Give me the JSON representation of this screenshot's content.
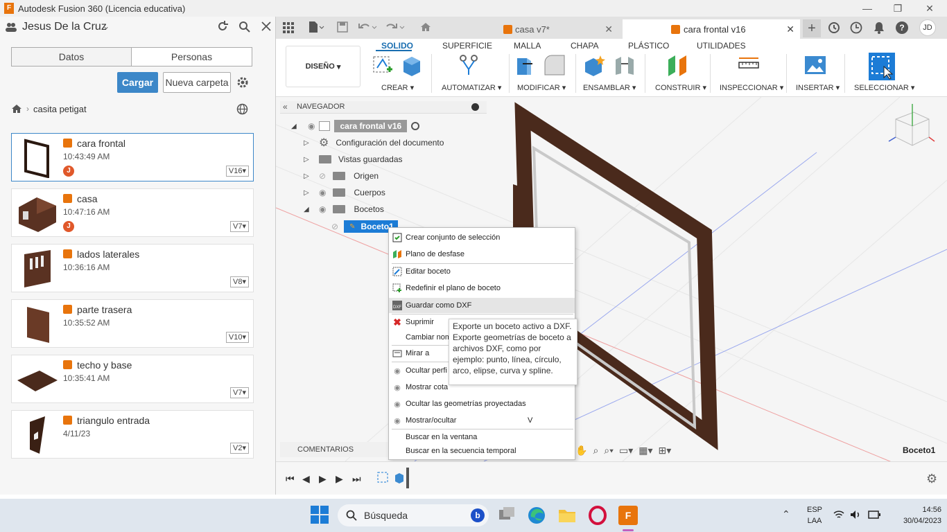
{
  "window": {
    "title": "Autodesk Fusion 360 (Licencia educativa)",
    "controls": [
      "—",
      "❐",
      "✕"
    ]
  },
  "left": {
    "user_name": "Jesus De la Cruz",
    "segments": [
      "Datos",
      "Personas"
    ],
    "upload_label": "Cargar",
    "new_folder_label": "Nueva carpeta",
    "breadcrumb": "casita petigat",
    "files": [
      {
        "name": "cara frontal",
        "time": "10:43:49 AM",
        "version": "V16",
        "avatar": "J"
      },
      {
        "name": "casa",
        "time": "10:47:16 AM",
        "version": "V7",
        "avatar": "J"
      },
      {
        "name": "lados laterales",
        "time": "10:36:16 AM",
        "version": "V8",
        "avatar": ""
      },
      {
        "name": "parte trasera",
        "time": "10:35:52 AM",
        "version": "V10",
        "avatar": ""
      },
      {
        "name": "techo y base",
        "time": "10:35:41 AM",
        "version": "V7",
        "avatar": ""
      },
      {
        "name": "triangulo entrada",
        "time": "4/11/23",
        "version": "V2",
        "avatar": ""
      }
    ]
  },
  "tabs": [
    {
      "label": "casa v7*"
    },
    {
      "label": "cara frontal v16"
    }
  ],
  "ribbon": {
    "mode": "DISEÑO",
    "tabs": [
      "SOLIDO",
      "SUPERFICIE",
      "MALLA",
      "CHAPA",
      "PLÁSTICO",
      "UTILIDADES"
    ],
    "groups": [
      "CREAR",
      "AUTOMATIZAR",
      "MODIFICAR",
      "ENSAMBLAR",
      "CONSTRUIR",
      "INSPECCIONAR",
      "INSERTAR",
      "SELECCIONAR"
    ]
  },
  "navigator": {
    "title": "NAVEGADOR",
    "root": "cara frontal v16",
    "items": [
      "Configuración del documento",
      "Vistas guardadas",
      "Origen",
      "Cuerpos",
      "Bocetos"
    ],
    "selected": "Boceto1"
  },
  "context_menu": {
    "items": [
      "Crear conjunto de selección",
      "Plano de desfase",
      "Editar boceto",
      "Redefinir el plano de boceto",
      "Guardar como DXF",
      "Suprimir",
      "Cambiar nom",
      "Mirar a",
      "Ocultar perfi",
      "Mostrar cota",
      "Ocultar las geometrías proyectadas",
      "Mostrar/ocultar",
      "Buscar en la ventana",
      "Buscar en la secuencia temporal"
    ],
    "shortcut_show_hide": "V"
  },
  "tooltip": "Exporte un boceto activo a DXF. Exporte geometrías de boceto a archivos DXF, como por ejemplo: punto, línea, círculo, arco, elipse, curva y spline.",
  "bottom": {
    "comments": "COMENTARIOS",
    "active_sketch": "Boceto1"
  },
  "taskbar": {
    "search": "Búsqueda",
    "lang": "ESP",
    "layout": "LAA",
    "time": "14:56",
    "date": "30/04/2023"
  },
  "colors": {
    "accent": "#3c87c8",
    "fusion_orange": "#e8740c",
    "wood": "#4a2a1c",
    "selection_blue": "#1c7cd6"
  }
}
